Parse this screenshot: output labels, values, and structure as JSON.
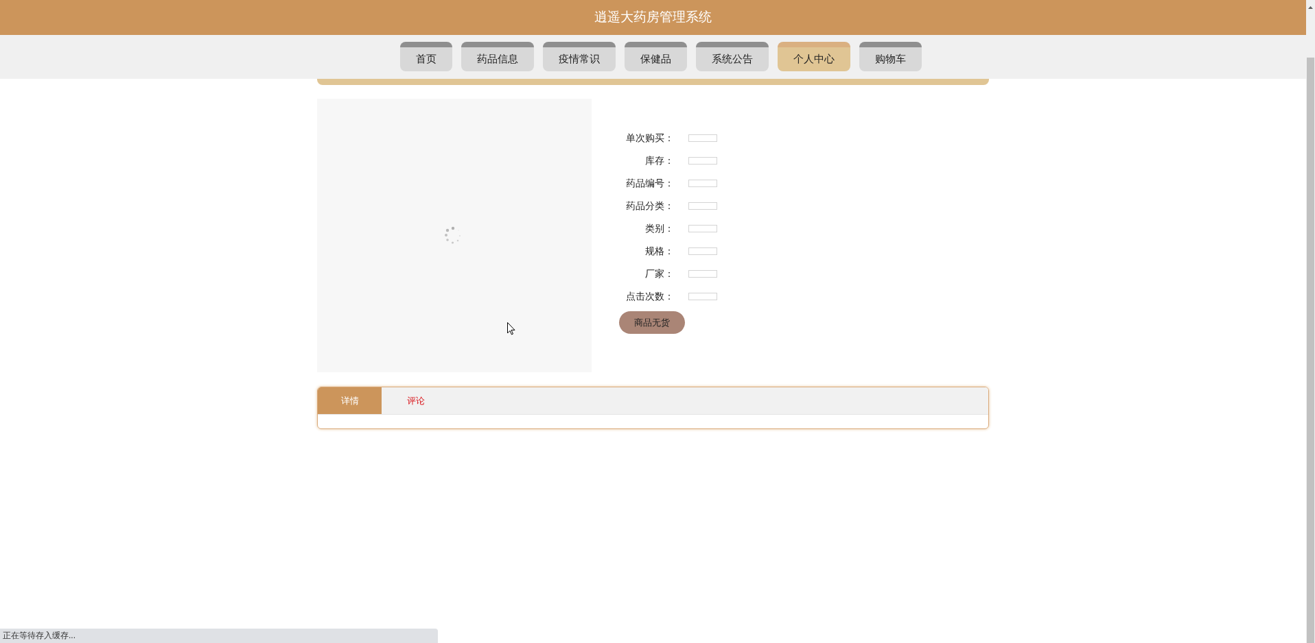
{
  "header": {
    "title": "逍遥大药房管理系统"
  },
  "nav": [
    {
      "label": "首页",
      "selected": false
    },
    {
      "label": "药品信息",
      "selected": false
    },
    {
      "label": "疫情常识",
      "selected": false
    },
    {
      "label": "保健品",
      "selected": false
    },
    {
      "label": "系统公告",
      "selected": false
    },
    {
      "label": "个人中心",
      "selected": true
    },
    {
      "label": "购物车",
      "selected": false
    }
  ],
  "product": {
    "image": {
      "kind": "picture",
      "loading": true
    },
    "fields": [
      {
        "label": "单次购买："
      },
      {
        "label": "库存："
      },
      {
        "label": "药品编号："
      },
      {
        "label": "药品分类："
      },
      {
        "label": "类别："
      },
      {
        "label": "规格："
      },
      {
        "label": "厂家："
      },
      {
        "label": "点击次数："
      }
    ],
    "button": "商品无货"
  },
  "tabs": [
    {
      "label": "详情",
      "selected": true
    },
    {
      "label": "评论",
      "selected": false
    }
  ],
  "status_bar": "正在等待存入缓存..."
}
